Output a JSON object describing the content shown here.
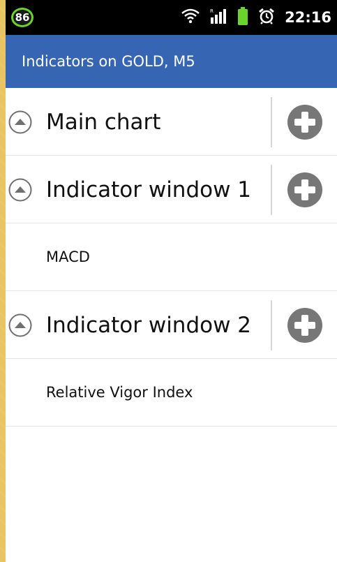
{
  "status_bar": {
    "battery_level": "86",
    "time": "22:16",
    "icons": [
      "wifi-icon",
      "signal-icon",
      "battery-icon",
      "alarm-icon"
    ]
  },
  "action_bar": {
    "title": "Indicators on GOLD, M5"
  },
  "groups": [
    {
      "label": "Main chart",
      "items": []
    },
    {
      "label": "Indicator window 1",
      "items": [
        "MACD"
      ]
    },
    {
      "label": "Indicator window 2",
      "items": [
        "Relative Vigor Index"
      ]
    }
  ],
  "colors": {
    "action_bar": "#3565b3",
    "battery_ring": "#6bd32e",
    "add_icon": "#777777"
  }
}
